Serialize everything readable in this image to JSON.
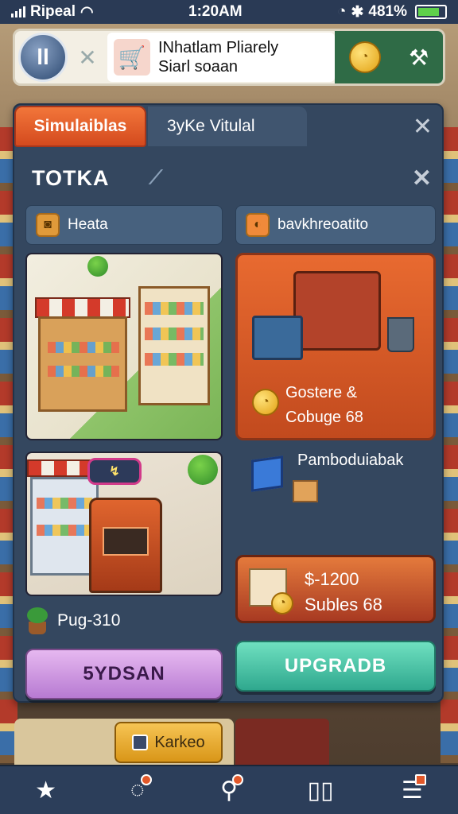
{
  "status": {
    "carrier": "Ripeal",
    "time": "1:20AM",
    "battery": "481%"
  },
  "banner": {
    "logo": "ll",
    "ad_line1": "INhatlam Pliarely",
    "ad_line2": "Siarl soaan"
  },
  "tabs": {
    "active": "Simulaiblas",
    "second": "3yKe Vitulal"
  },
  "panel": {
    "title": "TOTKA"
  },
  "left": {
    "label": "Heata",
    "plant_label": "Pug-310",
    "button": "5YDSAN"
  },
  "right": {
    "label": "bavkhreoatito",
    "card_line1": "Gostere &",
    "card_line2": "Cobuge 68",
    "item_label": "Pamboduiabak",
    "reward_line1": "$-1200",
    "reward_line2": "Subles 68",
    "button": "UPGRADB"
  },
  "bottom": {
    "button": "Karkeo"
  },
  "nav": [
    "star-icon",
    "map-pin-icon",
    "key-icon",
    "book-icon",
    "news-icon"
  ]
}
